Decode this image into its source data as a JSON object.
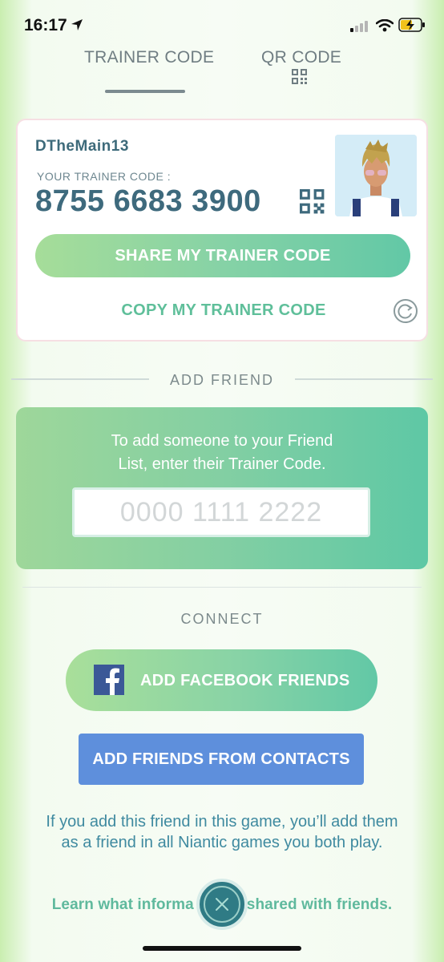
{
  "status_bar": {
    "time": "16:17"
  },
  "tabs": [
    {
      "label": "TRAINER CODE"
    },
    {
      "label": "QR CODE"
    }
  ],
  "trainer": {
    "name": "DTheMain13",
    "code_caption": "YOUR TRAINER CODE :",
    "code": "8755 6683 3900",
    "share_label": "SHARE MY TRAINER CODE",
    "copy_label": "COPY MY TRAINER CODE"
  },
  "add_friend": {
    "section_label": "ADD FRIEND",
    "instruction_line1": "To add someone to your Friend",
    "instruction_line2": "List, enter their Trainer Code.",
    "input_placeholder": "0000 1111 2222",
    "input_value": ""
  },
  "connect": {
    "section_label": "CONNECT",
    "facebook_label": "ADD FACEBOOK FRIENDS",
    "contacts_label": "ADD FRIENDS FROM CONTACTS",
    "disclaimer": "If you add this friend in this game, you’ll add them as a friend in all Niantic games you both play.",
    "learn_left": "Learn what informa",
    "learn_right": "shared with friends."
  },
  "colors": {
    "accent_green": "#62c8a6",
    "contacts_blue": "#5e8fdc",
    "facebook_blue": "#3b5897",
    "close_teal": "#2f7b85"
  }
}
